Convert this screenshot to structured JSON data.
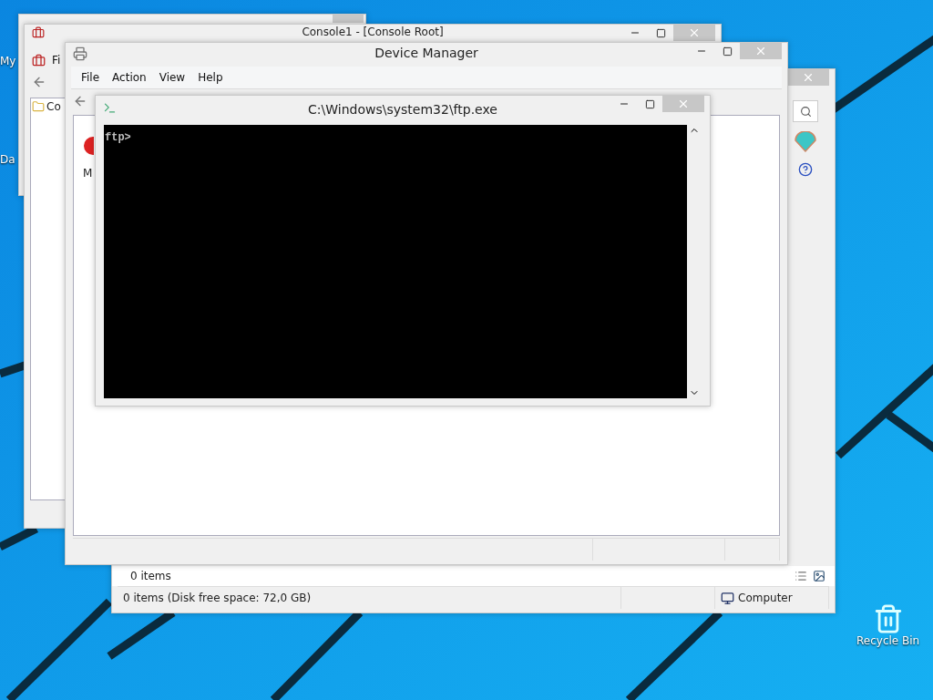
{
  "desktop_icons": [
    {
      "label": "My"
    },
    {
      "label": "Da"
    },
    {
      "label": "Recycle Bin"
    }
  ],
  "explorer_window": {
    "items_count": "0 items",
    "status_text": "0 items (Disk free space: 72,0 GB)",
    "location": "Computer"
  },
  "console_window": {
    "title": "Console1 - [Console Root]",
    "menu": [
      "Fi"
    ],
    "tree_items": [
      "Co"
    ]
  },
  "device_manager": {
    "title": "Device Manager",
    "menu": [
      "File",
      "Action",
      "View",
      "Help"
    ],
    "content_text": "M"
  },
  "ftp_window": {
    "title": "C:\\Windows\\system32\\ftp.exe",
    "console_text": "ftp>"
  }
}
